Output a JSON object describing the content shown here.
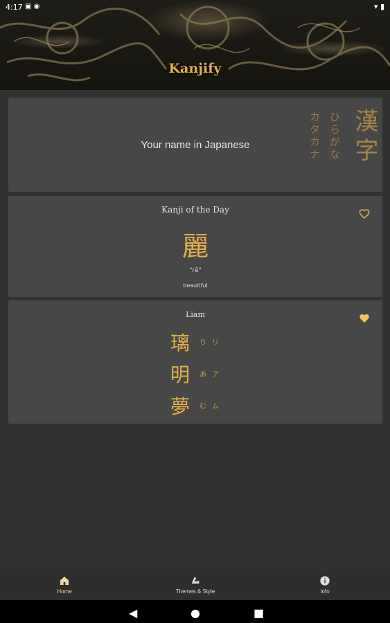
{
  "status_bar": {
    "time": "4:17"
  },
  "header": {
    "title": "Kanjify"
  },
  "card_name": {
    "text": "Your name in Japanese",
    "kanji": "漢字",
    "hiragana": "ひらがな",
    "katakana": "カタカナ"
  },
  "kanji_of_day": {
    "label": "Kanji of the Day",
    "kanji": "麗",
    "reading": "\"rē\"",
    "meaning": "beautiful",
    "favorited": false
  },
  "name_card": {
    "name": "Liam",
    "favorited": true,
    "rows": [
      {
        "kanji": "璃",
        "hiragana": "り",
        "katakana": "リ"
      },
      {
        "kanji": "明",
        "hiragana": "あ",
        "katakana": "ア"
      },
      {
        "kanji": "夢",
        "hiragana": "む",
        "katakana": "ム"
      }
    ]
  },
  "bottom_nav": {
    "items": [
      {
        "label": "Home",
        "icon": "home-icon",
        "active": true
      },
      {
        "label": "Themes & Style",
        "icon": "themes-icon",
        "active": false
      },
      {
        "label": "Info",
        "icon": "info-icon",
        "active": false
      }
    ]
  },
  "colors": {
    "accent": "#e2b04a",
    "background": "#323232",
    "card": "#474747",
    "nav_active": "#f2d6a0",
    "nav_inactive": "#dddddd"
  }
}
